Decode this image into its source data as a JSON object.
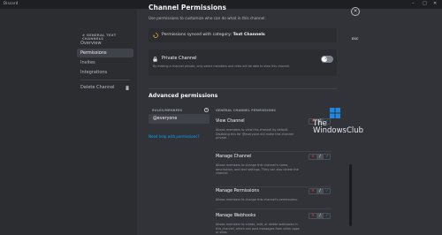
{
  "app": {
    "title": "Discord"
  },
  "sidebar": {
    "header": "# GENERAL TEXT CHANNELS",
    "items": [
      {
        "label": "Overview"
      },
      {
        "label": "Permissions"
      },
      {
        "label": "Invites"
      },
      {
        "label": "Integrations"
      }
    ],
    "delete_label": "Delete Channel"
  },
  "main": {
    "title": "Channel Permissions",
    "subtitle": "Use permissions to customize who can do what in this channel.",
    "sync": {
      "text": "Permissions synced with category:",
      "category": "Text Channels"
    },
    "private": {
      "title": "Private Channel",
      "description": "By making a channel private, only select members and roles will be able to view this channel.",
      "enabled": false
    },
    "esc_label": "ESC",
    "advanced_title": "Advanced permissions",
    "roles_label": "ROLES/MEMBERS",
    "role_selected": "@everyone",
    "help_link": "Need help with permissions?",
    "general_label": "GENERAL CHANNEL PERMISSIONS",
    "permissions": [
      {
        "title": "View Channel",
        "description": "Allows members to view this channel by default. Disabling this for @everyone will make this channel private."
      },
      {
        "title": "Manage Channel",
        "description": "Allows members to change this channel's name, description, and text settings. They can also delete the channel."
      },
      {
        "title": "Manage Permissions",
        "description": "Allows members to change this channel's permissions."
      },
      {
        "title": "Manage Webhooks",
        "description": "Allows members to create, edit, or delete webhooks in this channel, which can post messages from other apps or sites."
      }
    ]
  },
  "watermark": {
    "line1": "The",
    "line2": "WindowsClub"
  },
  "colors": {
    "accent": "#00a8fc",
    "deny": "#f23f43",
    "allow": "#23a55a",
    "background": "#313338",
    "sidebar": "#2b2d31"
  }
}
